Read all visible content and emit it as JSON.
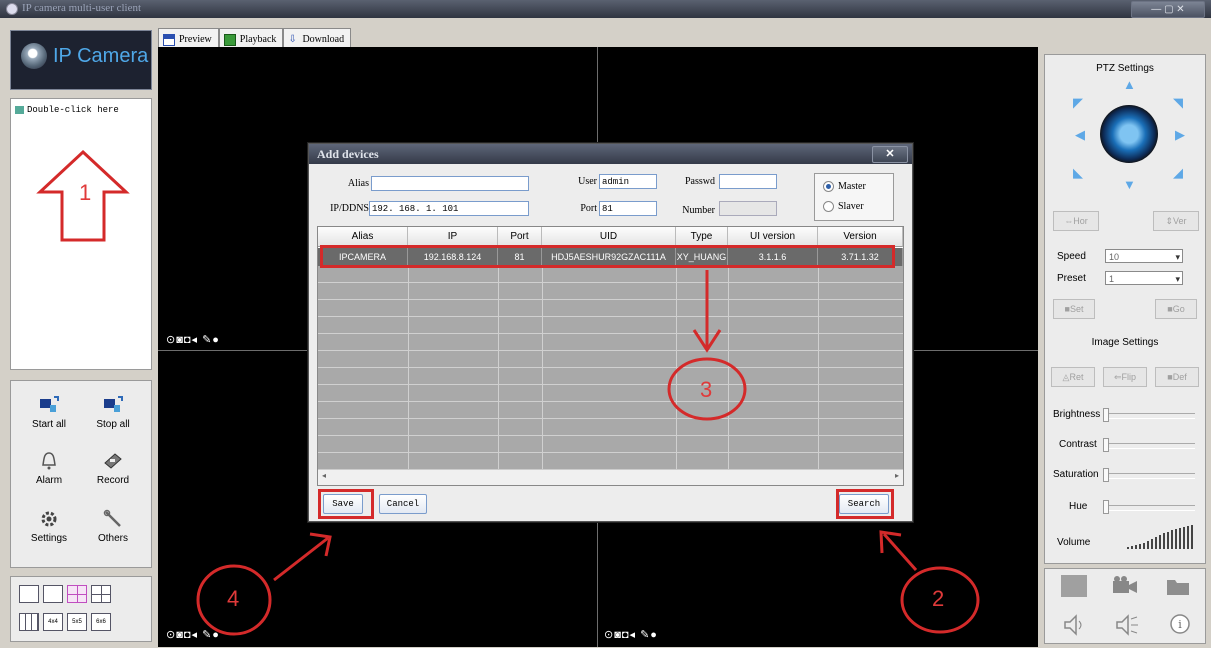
{
  "window": {
    "title": "IP camera multi-user client",
    "controls": "— ▢ ✕"
  },
  "logo": {
    "text": "IP Camera"
  },
  "device_list": {
    "item": "Double-click here"
  },
  "controls": {
    "start_all": "Start all",
    "stop_all": "Stop all",
    "alarm": "Alarm",
    "record": "Record",
    "settings": "Settings",
    "others": "Others"
  },
  "tabs": [
    {
      "label": "Preview",
      "icon": "preview-icon"
    },
    {
      "label": "Playback",
      "icon": "playback-icon"
    },
    {
      "label": "Download",
      "icon": "download-icon"
    }
  ],
  "video": {
    "toolbar_icons": "⊙◙◘◂ ✎●"
  },
  "dialog": {
    "title": "Add devices",
    "close": "✕",
    "fields": {
      "alias_label": "Alias",
      "alias_value": "",
      "user_label": "User",
      "user_value": "admin",
      "passwd_label": "Passwd",
      "passwd_value": "",
      "ipddns_label": "IP/DDNS",
      "ipddns_value": "192. 168. 1. 101",
      "port_label": "Port",
      "port_value": "81",
      "number_label": "Number",
      "number_value": ""
    },
    "mode": {
      "master": "Master",
      "slaver": "Slaver",
      "selected": "Master"
    },
    "table": {
      "columns": [
        "Alias",
        "IP",
        "Port",
        "UID",
        "Type",
        "UI version",
        "Version"
      ],
      "rows": [
        [
          "IPCAMERA",
          "192.168.8.124",
          "81",
          "HDJ5AESHUR92GZAC111A",
          "XY_HUANG",
          "3.1.1.6",
          "3.71.1.32"
        ]
      ]
    },
    "save": "Save",
    "cancel": "Cancel",
    "search": "Search"
  },
  "ptz": {
    "title": "PTZ Settings",
    "btn_hflip": "Hor",
    "btn_vflip": "Ver",
    "speed_label": "Speed",
    "speed_value": "10",
    "preset_label": "Preset",
    "preset_value": "1",
    "btn_set": "Set",
    "btn_go": "Go"
  },
  "image_settings": {
    "title": "Image Settings",
    "btn1": "Ret",
    "btn2": "Flip",
    "btn3": "Def",
    "brightness": "Brightness",
    "contrast": "Contrast",
    "saturation": "Saturation",
    "hue": "Hue",
    "volume": "Volume"
  },
  "annotations": {
    "n1": "1",
    "n2": "2",
    "n3": "3",
    "n4": "4"
  },
  "colors": {
    "accent_red": "#d42a2a",
    "dialog_title": "#343a48",
    "selected_row": "#6a6a6a"
  }
}
